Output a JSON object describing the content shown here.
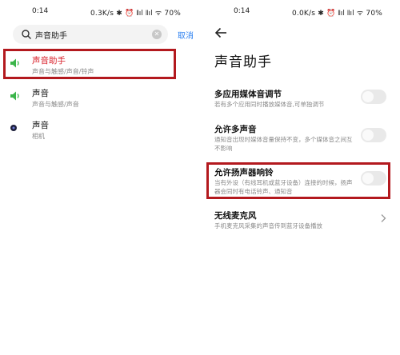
{
  "left": {
    "status": {
      "time": "0:14",
      "net": "0.3K/s ✱ ⏰ 𝍪ıl 𝍪ıl ᯤ 70%"
    },
    "search": {
      "query": "声音助手",
      "cancel_label": "取消"
    },
    "results": [
      {
        "title": "声音助手",
        "subtitle": "声音与触感/声音/铃声",
        "icon": "speaker-icon",
        "highlighted": true
      },
      {
        "title": "声音",
        "subtitle": "声音与触感/声音",
        "icon": "speaker-icon",
        "highlighted": false
      },
      {
        "title": "声音",
        "subtitle": "相机",
        "icon": "camera-dot-icon",
        "highlighted": false
      }
    ]
  },
  "right": {
    "status": {
      "time": "0:14",
      "net": "0.0K/s ✱ ⏰ 𝍪ıl 𝍪ıl ᯤ 70%"
    },
    "page_title": "声音助手",
    "settings": [
      {
        "title": "多应用媒体音调节",
        "desc": "若有多个应用同时播放媒体音,可单独调节",
        "control": "toggle",
        "on": false
      },
      {
        "title": "允许多声音",
        "desc": "通知音出现时媒体音量保持不变，多个媒体音之间互不影响",
        "control": "toggle",
        "on": false
      },
      {
        "title": "允许扬声器响铃",
        "desc": "当有外设（有线耳机或蓝牙设备）连接的时候，扬声器会同时有电话铃声、通知音",
        "control": "toggle",
        "on": false,
        "highlighted": true
      },
      {
        "title": "无线麦克风",
        "desc": "手机麦克风采集的声音传到蓝牙设备播放",
        "control": "chevron"
      }
    ]
  },
  "colors": {
    "highlight_border": "#b3191e",
    "accent_red": "#d9212b",
    "link_blue": "#2a7ff0",
    "speaker_green": "#3bb54a"
  }
}
